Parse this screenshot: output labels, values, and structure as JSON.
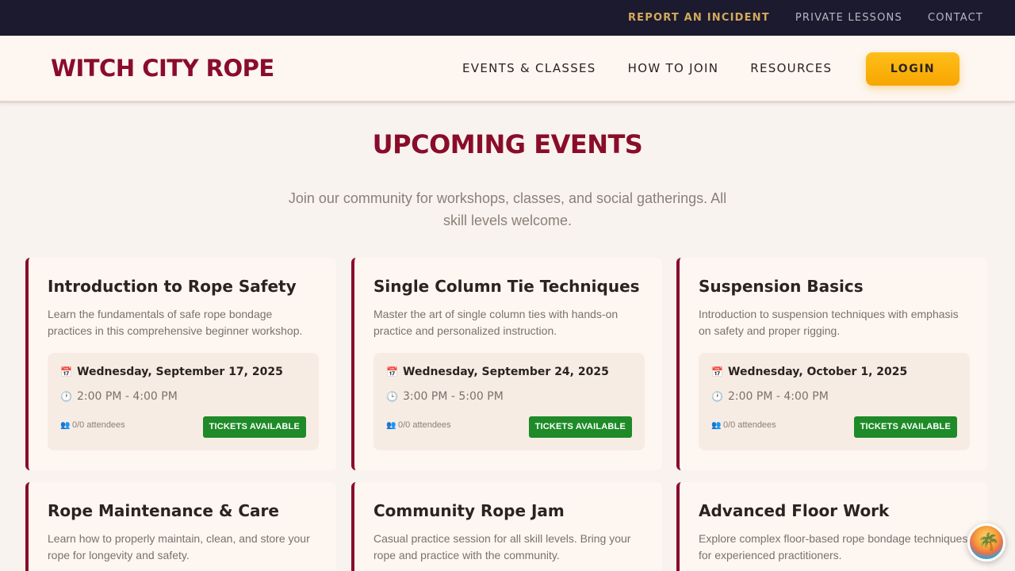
{
  "utility_nav": {
    "report_incident": "REPORT AN INCIDENT",
    "private_lessons": "PRIVATE LESSONS",
    "contact": "CONTACT"
  },
  "header": {
    "logo": "WITCH CITY ROPE",
    "nav": [
      "EVENTS & CLASSES",
      "HOW TO JOIN",
      "RESOURCES"
    ],
    "login": "LOGIN"
  },
  "section": {
    "title": "UPCOMING EVENTS",
    "subtitle": "Join our community for workshops, classes, and social gatherings. All skill levels welcome."
  },
  "events": [
    {
      "title": "Introduction to Rope Safety",
      "description": "Learn the fundamentals of safe rope bondage practices in this comprehensive beginner workshop.",
      "date": "Wednesday, September 17, 2025",
      "time": "2:00 PM - 4:00 PM",
      "attendees": "0/0 attendees",
      "status": "TICKETS AVAILABLE"
    },
    {
      "title": "Single Column Tie Techniques",
      "description": "Master the art of single column ties with hands-on practice and personalized instruction.",
      "date": "Wednesday, September 24, 2025",
      "time": "3:00 PM - 5:00 PM",
      "attendees": "0/0 attendees",
      "status": "TICKETS AVAILABLE"
    },
    {
      "title": "Suspension Basics",
      "description": "Introduction to suspension techniques with emphasis on safety and proper rigging.",
      "date": "Wednesday, October 1, 2025",
      "time": "2:00 PM - 4:00 PM",
      "attendees": "0/0 attendees",
      "status": "TICKETS AVAILABLE"
    },
    {
      "title": "Rope Maintenance & Care",
      "description": "Learn how to properly maintain, clean, and store your rope for longevity and safety."
    },
    {
      "title": "Community Rope Jam",
      "description": "Casual practice session for all skill levels. Bring your rope and practice with the community."
    },
    {
      "title": "Advanced Floor Work",
      "description": "Explore complex floor-based rope bondage techniques for experienced practitioners."
    }
  ],
  "icons": {
    "calendar": "calendar-icon",
    "clock": "clock-icon",
    "people": "people-icon",
    "chat": "palm-tree-chat-icon"
  },
  "colors": {
    "brand": "#8a0c2b",
    "topbar": "#1b1a2e",
    "incident": "#d4a95a",
    "login": "#ffb300",
    "tickets": "#1e8a28"
  }
}
